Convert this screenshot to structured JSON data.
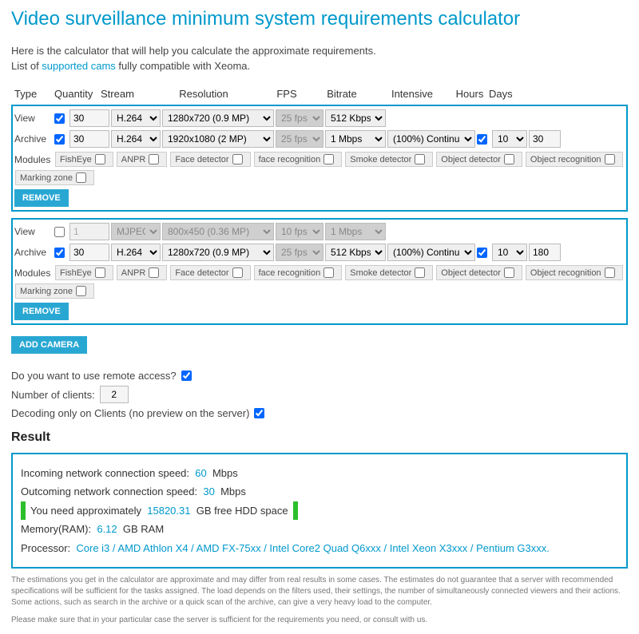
{
  "title": "Video surveillance minimum system requirements calculator",
  "intro1": "Here is the calculator that will help you calculate the approximate requirements.",
  "intro2_prefix": "List of ",
  "intro2_link": "supported cams",
  "intro2_suffix": " fully compatible with Xeoma.",
  "headers": {
    "type": "Type",
    "qty": "Quantity",
    "stream": "Stream",
    "res": "Resolution",
    "fps": "FPS",
    "bitrate": "Bitrate",
    "intensive": "Intensive",
    "hours": "Hours",
    "days": "Days"
  },
  "labels": {
    "view": "View",
    "archive": "Archive",
    "modules": "Modules",
    "remove": "REMOVE",
    "add": "ADD CAMERA"
  },
  "modules": [
    "FishEye",
    "ANPR",
    "Face detector",
    "face recognition",
    "Smoke detector",
    "Object detector",
    "Object recognition",
    "Marking zone"
  ],
  "cam1": {
    "view": {
      "qty": "30",
      "stream": "H.264",
      "res": "1280x720 (0.9 MP)",
      "fps": "25 fps",
      "bitrate": "512 Kbps"
    },
    "archive": {
      "qty": "30",
      "stream": "H.264",
      "res": "1920x1080 (2 MP)",
      "fps": "25 fps",
      "bitrate": "1 Mbps",
      "intensive": "(100%) Continu",
      "hours": "10",
      "days": "30"
    }
  },
  "cam2": {
    "view": {
      "qty": "1",
      "stream": "MJPEG",
      "res": "800x450 (0.36 MP)",
      "fps": "10 fps",
      "bitrate": "1 Mbps"
    },
    "archive": {
      "qty": "30",
      "stream": "H.264",
      "res": "1280x720 (0.9 MP)",
      "fps": "25 fps",
      "bitrate": "512 Kbps",
      "intensive": "(100%) Continu",
      "hours": "10",
      "days": "180"
    }
  },
  "remote": {
    "q": "Do you want to use remote access?",
    "clients_lbl": "Number of clients:",
    "clients": "2",
    "decode": "Decoding only on Clients (no preview on the server)"
  },
  "result": {
    "heading": "Result",
    "in_lbl": "Incoming network connection speed:",
    "in_val": "60",
    "mbps": "Mbps",
    "out_lbl": "Outcoming network connection speed:",
    "out_val": "30",
    "hdd_pre": "You need approximately",
    "hdd_val": "15820.31",
    "hdd_post": "GB free HDD space",
    "ram_lbl": "Memory(RAM):",
    "ram_val": "6.12",
    "ram_unit": "GB RAM",
    "cpu_lbl": "Processor:",
    "cpu_val": "Core i3 / AMD Athlon X4 / AMD FX-75xx / Intel Core2 Quad Q6xxx / Intel Xeon X3xxx / Pentium G3xxx."
  },
  "foot1": "The estimations you get in the calculator are approximate and may differ from real results in some cases. The estimates do not guarantee that a server with recommended specifications will be sufficient for the tasks assigned. The load depends on the filters used, their settings, the number of simultaneously connected viewers and their actions. Some actions, such as search in the archive or a quick scan of the archive, can give a very heavy load to the computer.",
  "foot2": "Please make sure that in your particular case the server is sufficient for the requirements you need, or consult with us."
}
